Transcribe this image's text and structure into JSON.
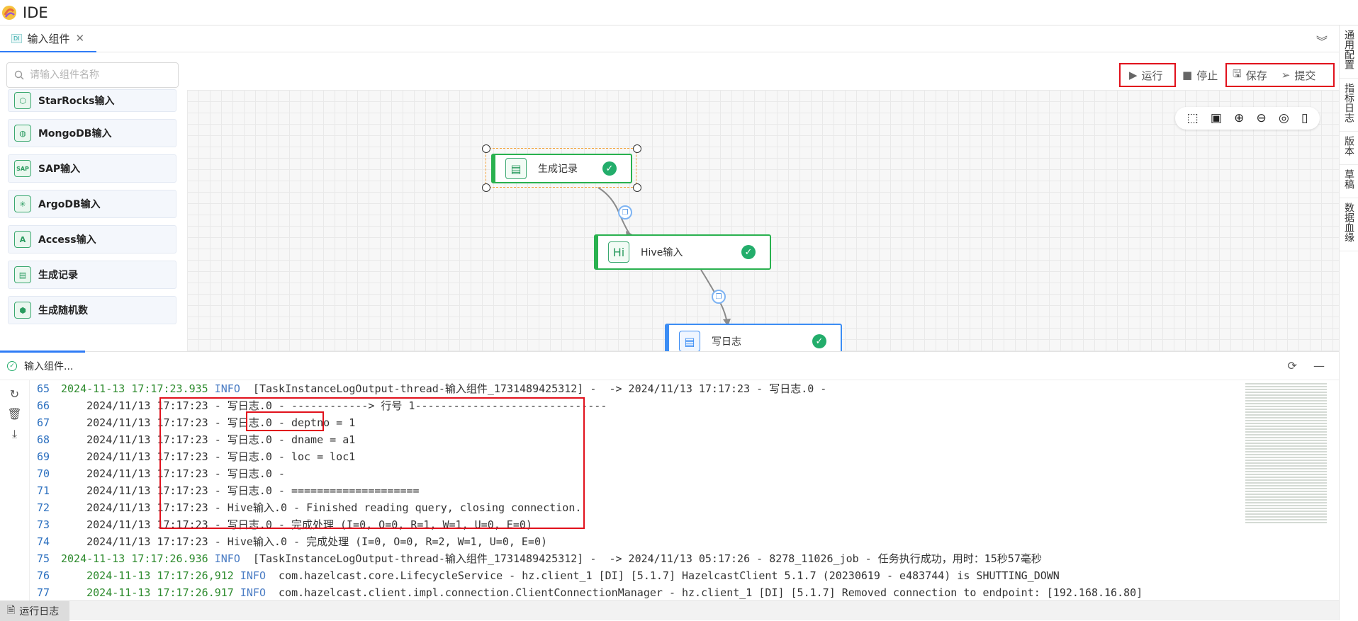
{
  "app": {
    "title": "IDE"
  },
  "tab": {
    "icon_text": "DI",
    "label": "输入组件",
    "close": "✕"
  },
  "sidebar": {
    "search_placeholder": "请输入组件名称",
    "items": [
      {
        "label": "StarRocks输入",
        "icon": "starrocks-icon",
        "glyph": "⬡"
      },
      {
        "label": "MongoDB输入",
        "icon": "mongodb-icon",
        "glyph": "◍"
      },
      {
        "label": "SAP输入",
        "icon": "sap-icon",
        "glyph": "SAP"
      },
      {
        "label": "ArgoDB输入",
        "icon": "argodb-icon",
        "glyph": "✳"
      },
      {
        "label": "Access输入",
        "icon": "access-icon",
        "glyph": "A"
      },
      {
        "label": "生成记录",
        "icon": "generate-record-icon",
        "glyph": "▤"
      },
      {
        "label": "生成随机数",
        "icon": "random-number-icon",
        "glyph": "⬢"
      }
    ]
  },
  "toolbar": {
    "run": "运行",
    "stop": "停止",
    "save": "保存",
    "submit": "提交"
  },
  "nodes": {
    "gen": "生成记录",
    "hive": "Hive输入",
    "hive_icon": "Hi",
    "log": "写日志"
  },
  "rightbar": [
    "通用配置",
    "指标日志",
    "版本",
    "草稿",
    "数据血缘"
  ],
  "log": {
    "header": "输入组件...",
    "lines": [
      {
        "n": "65",
        "ts": "2024-11-13 17:17:23.935",
        "lvl": "INFO",
        "text": "  [TaskInstanceLogOutput-thread-输入组件_1731489425312] -  -> 2024/11/13 17:17:23 - 写日志.0 -"
      },
      {
        "n": "66",
        "text": "    2024/11/13 17:17:23 - 写日志.0 - ------------> 行号 1------------------------------"
      },
      {
        "n": "67",
        "text": "    2024/11/13 17:17:23 - 写日志.0 - deptno = 1"
      },
      {
        "n": "68",
        "text": "    2024/11/13 17:17:23 - 写日志.0 - dname = a1"
      },
      {
        "n": "69",
        "text": "    2024/11/13 17:17:23 - 写日志.0 - loc = loc1"
      },
      {
        "n": "70",
        "text": "    2024/11/13 17:17:23 - 写日志.0 -"
      },
      {
        "n": "71",
        "text": "    2024/11/13 17:17:23 - 写日志.0 - ===================="
      },
      {
        "n": "72",
        "text": "    2024/11/13 17:17:23 - Hive输入.0 - Finished reading query, closing connection."
      },
      {
        "n": "73",
        "text": "    2024/11/13 17:17:23 - 写日志.0 - 完成处理 (I=0, O=0, R=1, W=1, U=0, E=0)"
      },
      {
        "n": "74",
        "text": "    2024/11/13 17:17:23 - Hive输入.0 - 完成处理 (I=0, O=0, R=2, W=1, U=0, E=0)"
      },
      {
        "n": "75",
        "ts": "2024-11-13 17:17:26.936",
        "lvl": "INFO",
        "text": "  [TaskInstanceLogOutput-thread-输入组件_1731489425312] -  -> 2024/11/13 05:17:26 - 8278_11026_job - 任务执行成功，用时：15秒57毫秒"
      },
      {
        "n": "76",
        "ts": "    2024-11-13 17:17:26,912",
        "lvl": "INFO",
        "text": "  com.hazelcast.core.LifecycleService - hz.client_1 [DI] [5.1.7] HazelcastClient 5.1.7 (20230619 - e483744) is SHUTTING_DOWN"
      },
      {
        "n": "77",
        "ts": "    2024-11-13 17:17:26.917",
        "lvl": "INFO",
        "text": "  com.hazelcast.client.impl.connection.ClientConnectionManager - hz.client_1 [DI] [5.1.7] Removed connection to endpoint: [192.168.16.80]"
      }
    ]
  },
  "status": {
    "tab": "运行日志"
  }
}
